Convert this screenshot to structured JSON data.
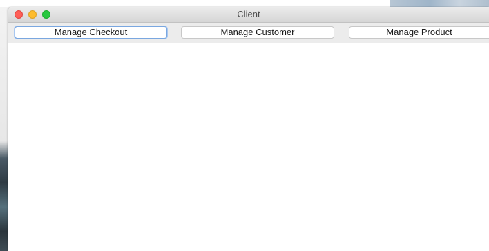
{
  "window": {
    "title": "Client"
  },
  "toolbar": {
    "buttons": [
      {
        "label": "Manage Checkout",
        "focused": true
      },
      {
        "label": "Manage Customer",
        "focused": false
      },
      {
        "label": "Manage Product",
        "focused": false
      }
    ]
  },
  "colors": {
    "close": "#fe5f57",
    "minimize": "#febc2e",
    "zoom": "#28c840",
    "focus_ring": "#7aa7e0"
  }
}
